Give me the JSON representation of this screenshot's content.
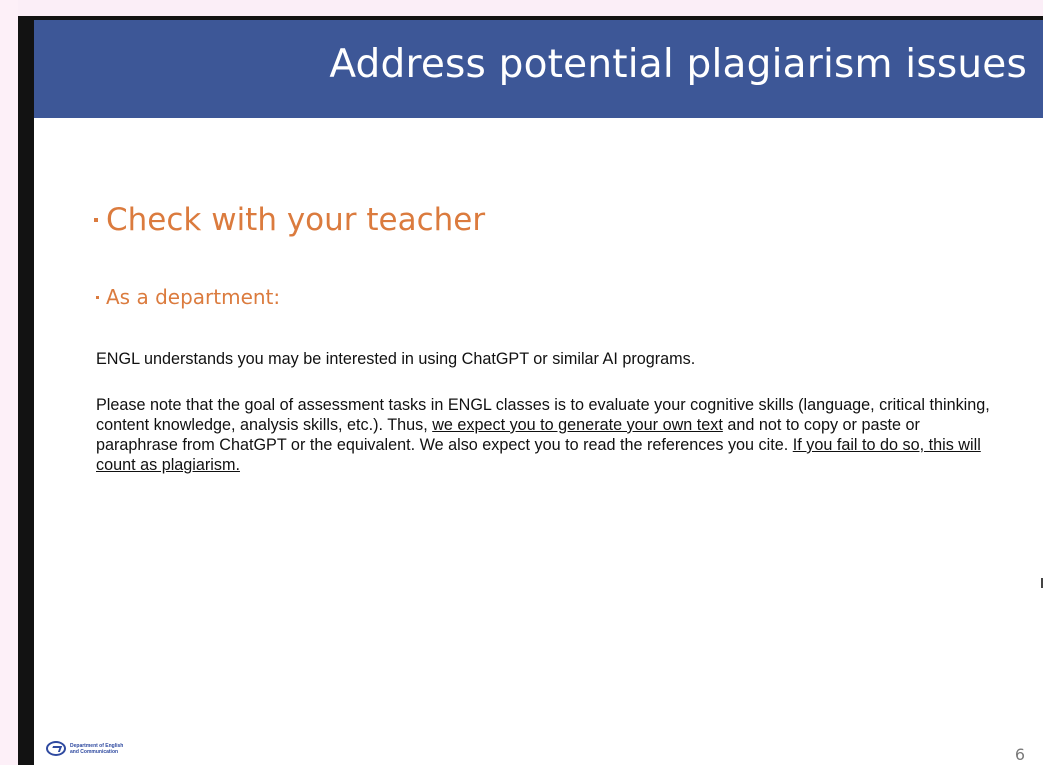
{
  "slide": {
    "title": "Address potential plagiarism issues",
    "bullet_level1": "Check with your teacher",
    "bullet_level2": "As a department:",
    "paragraph1": "ENGL understands you may be interested in using ChatGPT or similar AI programs.",
    "paragraph2": {
      "part1": "Please note that the goal of assessment tasks in ENGL classes is to evaluate your cognitive skills (language, critical thinking, content knowledge, analysis skills, etc.). Thus, ",
      "underlined1": "we expect you to generate your own text",
      "part2": " and not to copy or paste or paraphrase from ChatGPT or the equivalent. We also expect you to read the references you cite. ",
      "underlined2": "If you fail to do so, this will count as plagiarism."
    },
    "logo": {
      "line1": "Department of English",
      "line2": "and Communication"
    },
    "page_number": "6"
  },
  "colors": {
    "header_bg": "#3d5797",
    "accent_orange": "#db7b3e",
    "body_text": "#111111"
  }
}
